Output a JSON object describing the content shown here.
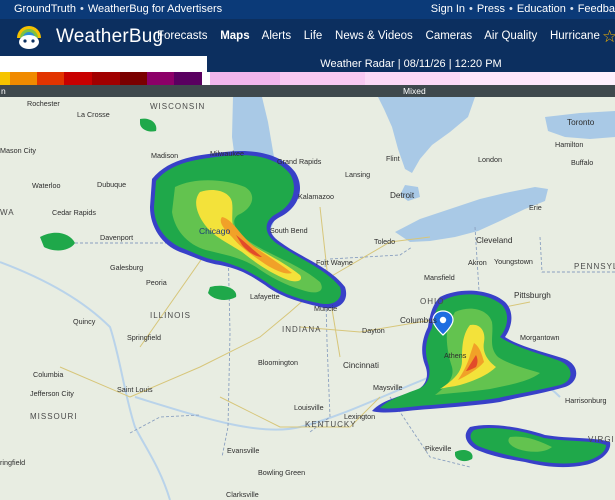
{
  "topbar": {
    "left_links": [
      "GroundTruth",
      "WeatherBug for Advertisers"
    ],
    "right_links": [
      "Sign In",
      "Press",
      "Education",
      "Feedba"
    ]
  },
  "brand": {
    "name": "WeatherBug"
  },
  "nav": {
    "items": [
      "Forecasts",
      "Maps",
      "Alerts",
      "Life",
      "News & Videos",
      "Cameras",
      "Air Quality",
      "Hurricane"
    ],
    "active": "Maps"
  },
  "radar": {
    "title": "Weather Radar | 08/11/26 | 12:20 PM",
    "legend_labels": {
      "rain": "n",
      "mixed": "Mixed"
    },
    "legend_colors": [
      "#f6c400",
      "#f08a00",
      "#e23400",
      "#c80000",
      "#a10000",
      "#7a0000",
      "#8c0068",
      "#5a0060",
      "#ffffff",
      "#f2b5ec",
      "#f8c9f2",
      "#fbd9f6",
      "#fde6fa",
      "#fef0fc"
    ]
  },
  "map": {
    "cities": [
      {
        "name": "Rochester"
      },
      {
        "name": "La Crosse"
      },
      {
        "name": "Mason City"
      },
      {
        "name": "Madison"
      },
      {
        "name": "Milwaukee"
      },
      {
        "name": "Grand Rapids"
      },
      {
        "name": "Flint"
      },
      {
        "name": "London"
      },
      {
        "name": "Toronto"
      },
      {
        "name": "Hamilton"
      },
      {
        "name": "Buffalo"
      },
      {
        "name": "Waterloo"
      },
      {
        "name": "Dubuque"
      },
      {
        "name": "Lansing"
      },
      {
        "name": "Kalamazoo"
      },
      {
        "name": "Detroit"
      },
      {
        "name": "Cedar Rapids"
      },
      {
        "name": "Chicago"
      },
      {
        "name": "South Bend"
      },
      {
        "name": "Toledo"
      },
      {
        "name": "Cleveland"
      },
      {
        "name": "Erie"
      },
      {
        "name": "Davenport"
      },
      {
        "name": "Galesburg"
      },
      {
        "name": "Peoria"
      },
      {
        "name": "Fort Wayne"
      },
      {
        "name": "Akron"
      },
      {
        "name": "Youngstown"
      },
      {
        "name": "Mansfield"
      },
      {
        "name": "Pittsburgh"
      },
      {
        "name": "Lafayette"
      },
      {
        "name": "Muncie"
      },
      {
        "name": "Quincy"
      },
      {
        "name": "Springfield"
      },
      {
        "name": "Dayton"
      },
      {
        "name": "Columbus"
      },
      {
        "name": "Morgantown"
      },
      {
        "name": "Bloomington"
      },
      {
        "name": "Cincinnati"
      },
      {
        "name": "Athens"
      },
      {
        "name": "Columbia"
      },
      {
        "name": "Jefferson City"
      },
      {
        "name": "Saint Louis"
      },
      {
        "name": "Maysville"
      },
      {
        "name": "Harrisonburg"
      },
      {
        "name": "Louisville"
      },
      {
        "name": "Lexington"
      },
      {
        "name": "Evansville"
      },
      {
        "name": "Pikeville"
      },
      {
        "name": "Bowling Green"
      },
      {
        "name": "Clarksville"
      },
      {
        "name": "ringfield"
      }
    ],
    "states": [
      "WISCONSIN",
      "ILLINOIS",
      "INDIANA",
      "OHIO",
      "MISSOURI",
      "KENTUCKY",
      "PENNSYL",
      "VIRGINIA",
      "WA"
    ],
    "colors": {
      "land": "#e8ede2",
      "water": "#a9c9e6",
      "rain_light": "#1fa84a",
      "rain_mid": "#63c34f",
      "rain_yellow": "#f3e23a",
      "rain_orange": "#f1a128",
      "rain_red": "#e24b2a",
      "rain_edge": "#3840c8",
      "pin": "#1f6de0"
    }
  }
}
